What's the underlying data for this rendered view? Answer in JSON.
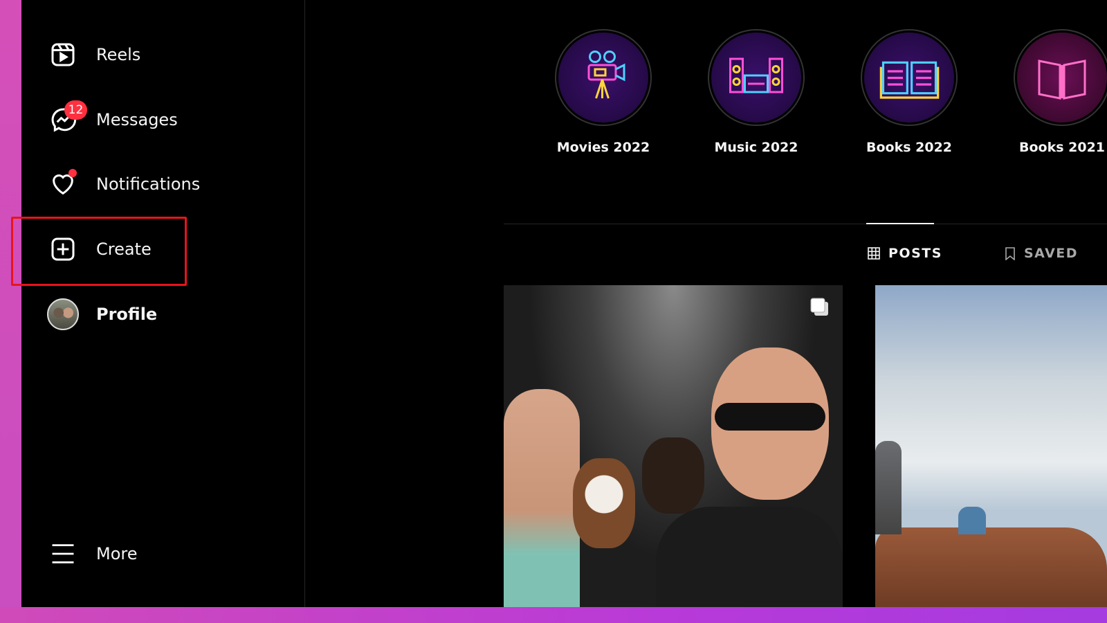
{
  "sidebar": {
    "items": [
      {
        "label": "Reels",
        "icon": "reels-icon"
      },
      {
        "label": "Messages",
        "icon": "messenger-icon",
        "badge": "12"
      },
      {
        "label": "Notifications",
        "icon": "heart-icon"
      },
      {
        "label": "Create",
        "icon": "plus-square-icon"
      },
      {
        "label": "Profile",
        "icon": "avatar"
      },
      {
        "label": "More",
        "icon": "hamburger-icon"
      }
    ]
  },
  "highlights": [
    {
      "label": "Movies 2022",
      "icon": "movie-camera-icon"
    },
    {
      "label": "Music 2022",
      "icon": "stereo-icon"
    },
    {
      "label": "Books 2022",
      "icon": "open-book-icon"
    },
    {
      "label": "Books 2021",
      "icon": "book-icon"
    }
  ],
  "tabs": [
    {
      "label": "POSTS",
      "icon": "grid-icon",
      "active": true
    },
    {
      "label": "SAVED",
      "icon": "bookmark-icon",
      "active": false
    }
  ],
  "colors": {
    "badge": "#ff3040",
    "highlight_box": "#e8141c",
    "background": "#000000"
  }
}
